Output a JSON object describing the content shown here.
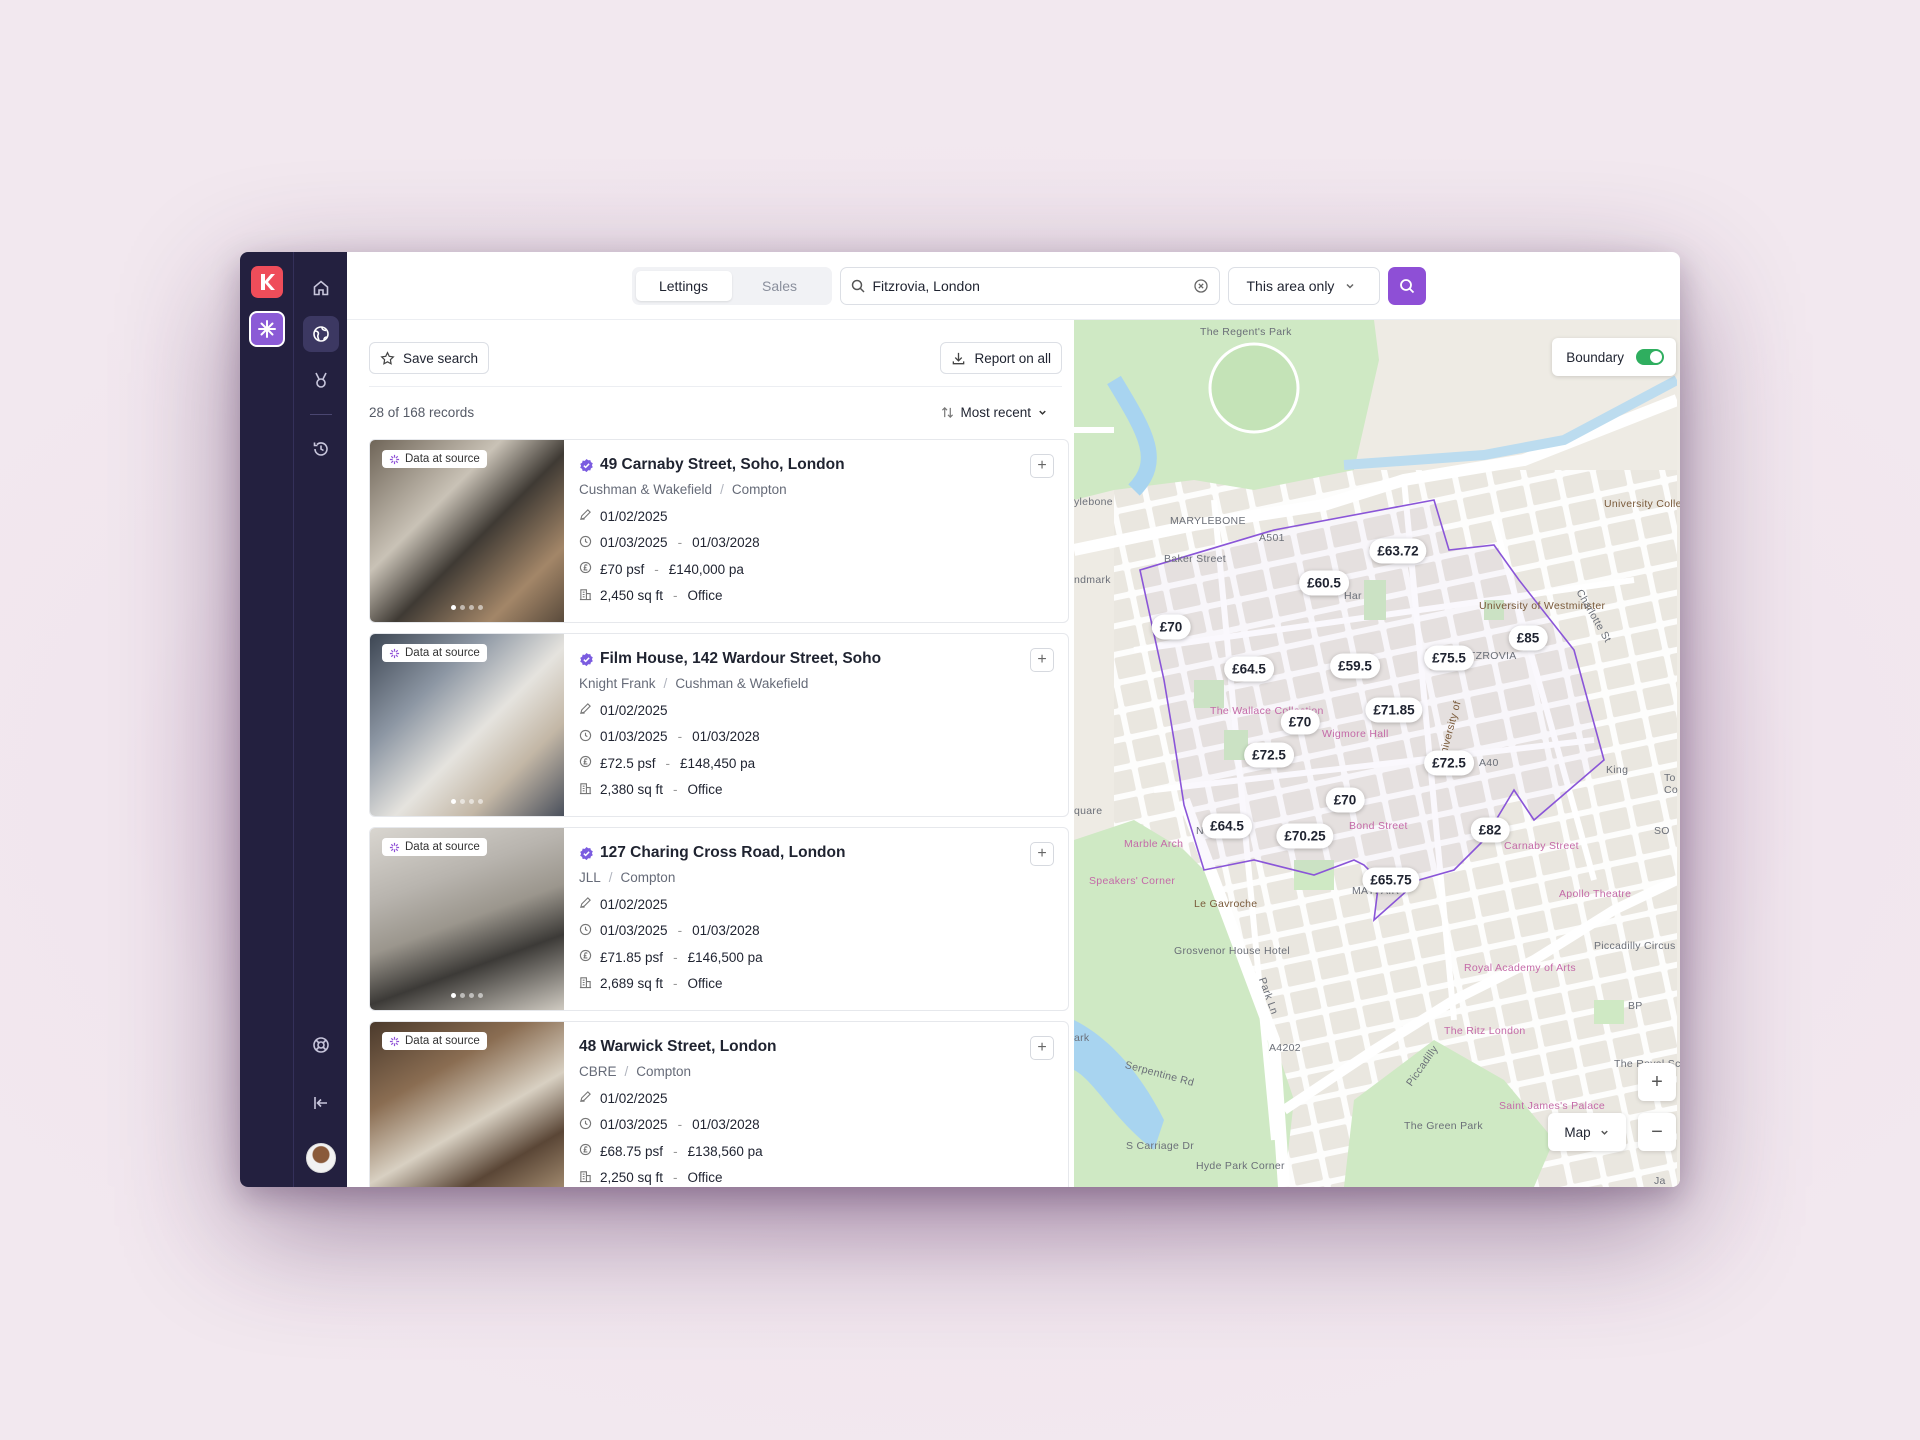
{
  "tabs": [
    {
      "label": "Lettings",
      "active": true
    },
    {
      "label": "Sales",
      "active": false
    }
  ],
  "search": {
    "value": "Fitzrovia, London"
  },
  "area_filter": {
    "label": "This area only"
  },
  "list": {
    "save_label": "Save search",
    "report_label": "Report on all",
    "count_text": "28 of 168 records",
    "sort_label": "Most recent"
  },
  "badge_text": "Data at source",
  "listings": [
    {
      "title": "49 Carnaby Street, Soho, London",
      "verified": true,
      "agent1": "Cushman & Wakefield",
      "agent2": "Compton",
      "date": "01/02/2025",
      "term_start": "01/03/2025",
      "term_end": "01/03/2028",
      "rate": "£70 psf",
      "rent": "£140,000 pa",
      "size": "2,450 sq ft",
      "use": "Office"
    },
    {
      "title": "Film House, 142 Wardour Street, Soho",
      "verified": true,
      "agent1": "Knight Frank",
      "agent2": "Cushman & Wakefield",
      "date": "01/02/2025",
      "term_start": "01/03/2025",
      "term_end": "01/03/2028",
      "rate": "£72.5 psf",
      "rent": "£148,450 pa",
      "size": "2,380 sq ft",
      "use": "Office"
    },
    {
      "title": "127 Charing Cross Road, London",
      "verified": true,
      "agent1": "JLL",
      "agent2": "Compton",
      "date": "01/02/2025",
      "term_start": "01/03/2025",
      "term_end": "01/03/2028",
      "rate": "£71.85 psf",
      "rent": "£146,500 pa",
      "size": "2,689 sq ft",
      "use": "Office"
    },
    {
      "title": "48 Warwick Street, London",
      "verified": false,
      "agent1": "CBRE",
      "agent2": "Compton",
      "date": "01/02/2025",
      "term_start": "01/03/2025",
      "term_end": "01/03/2028",
      "rate": "£68.75 psf",
      "rent": "£138,560 pa",
      "size": "2,250 sq ft",
      "use": "Office"
    }
  ],
  "map": {
    "boundary_label": "Boundary",
    "boundary_on": true,
    "type_label": "Map",
    "zoom_in": "+",
    "zoom_out": "−",
    "price_pins": [
      "£63.72",
      "£60.5",
      "£70",
      "£64.5",
      "£59.5",
      "£75.5",
      "£85",
      "£71.85",
      "£70",
      "£72.5",
      "£72.5",
      "£70",
      "£64.5",
      "£70.25",
      "£82",
      "£65.75"
    ],
    "labels": [
      "The Regent's Park",
      "MARYLEBONE",
      "Baker Street",
      "ylebone",
      "ndmark",
      "University College London",
      "University of Westminster",
      "FITZROVIA",
      "Charlotte St",
      "The Wallace Collection",
      "Wigmore Hall",
      "University of",
      "King",
      "quare",
      "Marble Arch",
      "N Row",
      "Bond Street",
      "Carnaby Street",
      "Speakers' Corner",
      "Le Gavroche",
      "MAYFAIR",
      "Apollo Theatre",
      "SO",
      "Grosvenor House Hotel",
      "Piccadilly Circus",
      "Royal Academy of Arts",
      "BP",
      "ark",
      "Park Ln",
      "The Ritz London",
      "Piccadilly",
      "The Royal Sc",
      "Serpentine Rd",
      "Saint James's Palace",
      "The Green Park",
      "S Carriage Dr",
      "Hyde Park Corner",
      "Ja",
      "To",
      "Co",
      "A501",
      "A4202",
      "A40",
      "Har"
    ]
  },
  "colors": {
    "sidebar": "#23203f",
    "accent": "#8e4fd6",
    "logo": "#ef4d5a",
    "boundary": "#8a55d8",
    "toggle_on": "#2fae5f"
  }
}
